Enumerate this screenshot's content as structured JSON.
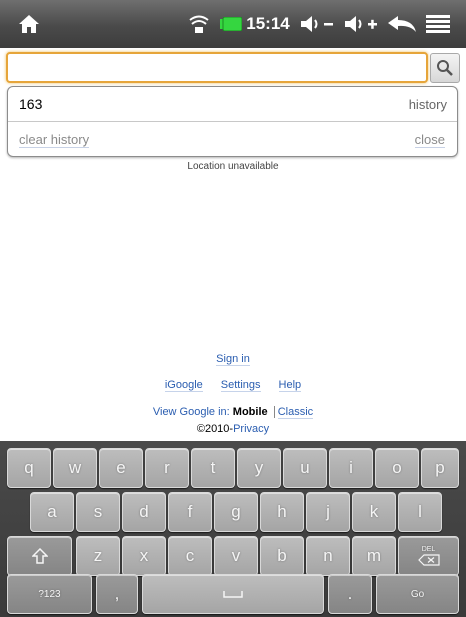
{
  "status_bar": {
    "time": "15:14",
    "icons": [
      "home-icon",
      "wifi-icon",
      "battery-icon",
      "volume-down-icon",
      "volume-up-icon",
      "back-icon",
      "menu-icon"
    ],
    "battery_color": "#35d640"
  },
  "search": {
    "value": "",
    "placeholder": "",
    "accent_color": "#e6a53a"
  },
  "suggestions": {
    "items": [
      {
        "query": "163",
        "type": "history"
      }
    ],
    "clear_label": "clear history",
    "close_label": "close"
  },
  "location_text": "Location unavailable",
  "footer": {
    "sign_in": "Sign in",
    "links": [
      "iGoogle",
      "Settings",
      "Help"
    ],
    "view_prefix": "View Google in:",
    "view_mobile": "Mobile",
    "view_classic": "Classic",
    "copyright": "©2010-",
    "privacy": "Privacy"
  },
  "keyboard": {
    "row1": [
      "q",
      "w",
      "e",
      "r",
      "t",
      "y",
      "u",
      "i",
      "o",
      "p"
    ],
    "row2": [
      "a",
      "s",
      "d",
      "f",
      "g",
      "h",
      "j",
      "k",
      "l"
    ],
    "row3": [
      "z",
      "x",
      "c",
      "v",
      "b",
      "n",
      "m"
    ],
    "shift_icon": "shift-icon",
    "delete_label": "DEL",
    "mode_label": "?123",
    "comma": ",",
    "period": ".",
    "go_label": "Go",
    "space_icon": "space-icon"
  }
}
